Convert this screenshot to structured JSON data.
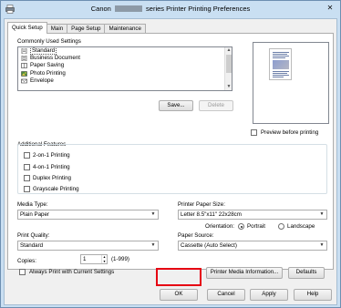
{
  "window": {
    "title_prefix": "Canon",
    "title_suffix": "series Printer Printing Preferences",
    "close_label": "✕"
  },
  "tabs": [
    {
      "label": "Quick Setup",
      "active": true
    },
    {
      "label": "Main",
      "active": false
    },
    {
      "label": "Page Setup",
      "active": false
    },
    {
      "label": "Maintenance",
      "active": false
    }
  ],
  "commonly_used": {
    "label": "Commonly Used Settings",
    "items": [
      {
        "label": "Standard",
        "icon": "document-icon",
        "selected": true
      },
      {
        "label": "Business Document",
        "icon": "document-text-icon",
        "selected": false
      },
      {
        "label": "Paper Saving",
        "icon": "paper-saving-icon",
        "selected": false
      },
      {
        "label": "Photo Printing",
        "icon": "photo-icon",
        "selected": false
      },
      {
        "label": "Envelope",
        "icon": "envelope-icon",
        "selected": false
      }
    ],
    "save_label": "Save...",
    "delete_label": "Delete"
  },
  "preview": {
    "checkbox_label": "Preview before printing",
    "checked": false
  },
  "additional_features": {
    "label": "Additional Features",
    "items": [
      {
        "label": "2-on-1 Printing",
        "checked": false
      },
      {
        "label": "4-on-1 Printing",
        "checked": false
      },
      {
        "label": "Duplex Printing",
        "checked": false
      },
      {
        "label": "Grayscale Printing",
        "checked": false
      }
    ]
  },
  "media_type": {
    "label": "Media Type:",
    "value": "Plain Paper"
  },
  "paper_size": {
    "label": "Printer Paper Size:",
    "value": "Letter 8.5\"x11\" 22x28cm"
  },
  "orientation": {
    "label": "Orientation:",
    "portrait_label": "Portrait",
    "landscape_label": "Landscape",
    "selected": "Portrait"
  },
  "print_quality": {
    "label": "Print Quality:",
    "value": "Standard"
  },
  "paper_source": {
    "label": "Paper Source:",
    "value": "Cassette (Auto Select)"
  },
  "copies": {
    "label": "Copies:",
    "value": "1",
    "range": "(1-999)"
  },
  "always_print": {
    "label": "Always Print with Current Settings",
    "checked": false
  },
  "media_info_label": "Printer Media Information...",
  "defaults_label": "Defaults",
  "buttons": {
    "ok": "OK",
    "cancel": "Cancel",
    "apply": "Apply",
    "help": "Help"
  },
  "colors": {
    "highlight": "#e60012",
    "titlebar": "#c9dff2"
  }
}
